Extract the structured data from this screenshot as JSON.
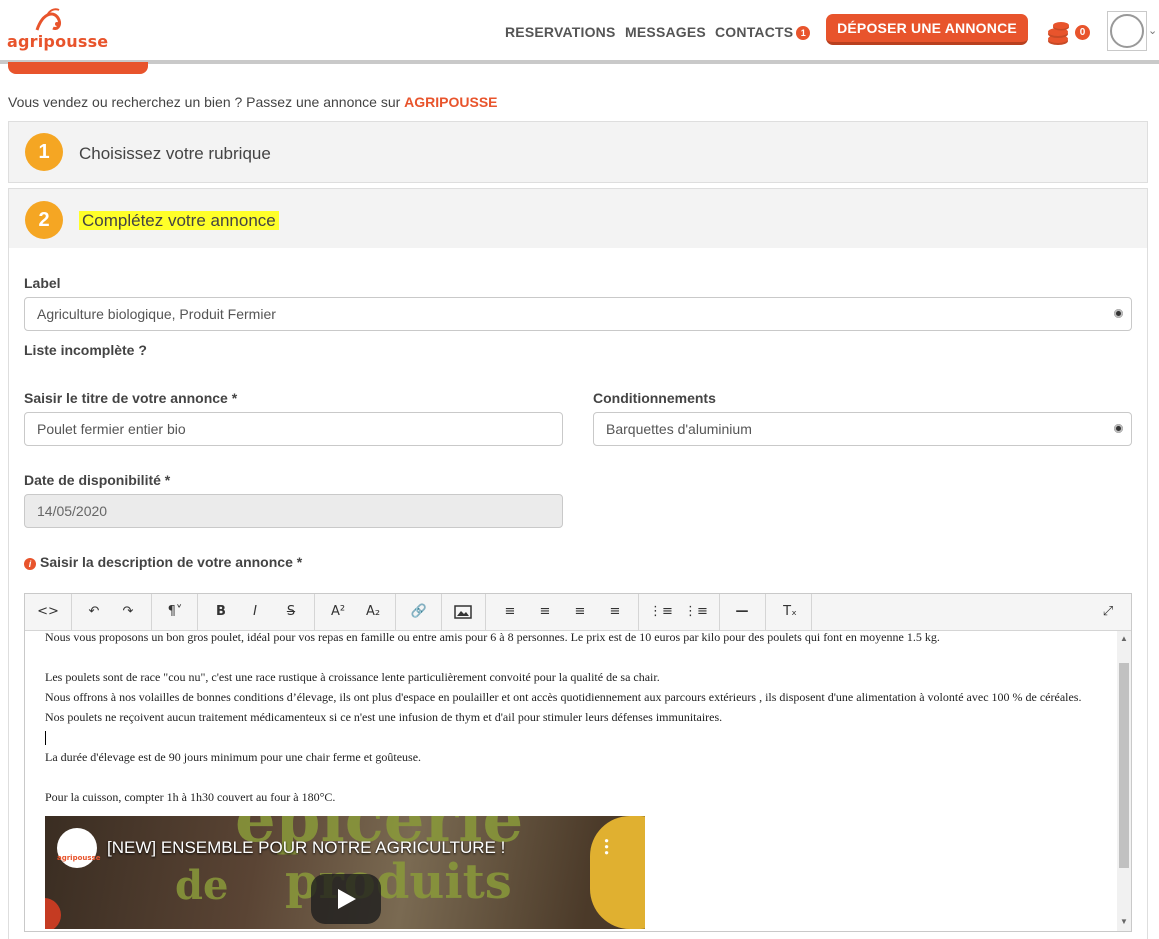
{
  "header": {
    "logo_text": "agripousse",
    "nav": [
      {
        "label": "RESERVATIONS"
      },
      {
        "label": "MESSAGES"
      },
      {
        "label": "CONTACTS",
        "badge": "1"
      }
    ],
    "deposit_button": "DÉPOSER UNE ANNONCE",
    "coins_count": "0",
    "colors": {
      "brand": "#e8542c",
      "step_badge": "#f5a623",
      "highlight": "#ffff29"
    }
  },
  "intro": {
    "text": "Vous vendez ou recherchez un bien ? Passez une annonce sur ",
    "brand": "AGRIPOUSSE"
  },
  "steps": [
    {
      "number": "1",
      "title": "Choisissez votre rubrique"
    },
    {
      "number": "2",
      "title": "Complétez votre annonce"
    }
  ],
  "form": {
    "label_title": "Label",
    "label_value": "Agriculture biologique, Produit Fermier",
    "incomplete_link": "Liste incomplète ?",
    "title_label": "Saisir le titre de votre annonce *",
    "title_value": "Poulet fermier entier bio",
    "packaging_label": "Conditionnements",
    "packaging_value": "Barquettes d'aluminium",
    "date_label": "Date de disponibilité *",
    "date_value": "14/05/2020",
    "description_label": "Saisir la description de votre annonce *"
  },
  "editor": {
    "toolbar_icons": [
      "source-icon",
      "undo-icon",
      "redo-icon",
      "paragraph-icon",
      "bold-icon",
      "italic-icon",
      "strikethrough-icon",
      "superscript-icon",
      "subscript-icon",
      "link-icon",
      "image-icon",
      "align-left-icon",
      "align-center-icon",
      "align-right-icon",
      "align-justify-icon",
      "bullet-list-icon",
      "numbered-list-icon",
      "horizontal-rule-icon",
      "clear-format-icon",
      "fullscreen-icon"
    ],
    "paragraphs": [
      "Nous vous proposons un bon gros poulet, idéal pour vos repas en famille ou entre amis pour 6 à 8 personnes. Le prix est de 10 euros par kilo pour des poulets qui font en moyenne 1.5 kg.",
      "",
      "Les poulets sont de race \"cou nu\", c'est une race rustique à croissance lente particulièrement convoité pour la qualité de sa chair.",
      "Nous offrons à nos volailles de bonnes conditions d’élevage, ils ont plus d'espace en poulailler et ont accès quotidiennement aux parcours extérieurs , ils disposent d'une alimentation à volonté avec 100 % de céréales. Nos poulets ne reçoivent aucun traitement médicamenteux si ce n'est une infusion de thym et d'ail pour stimuler leurs défenses immunitaires.",
      "La durée d'élevage est de 90 jours minimum pour une chair ferme et goûteuse.",
      "",
      "Pour la cuisson, compter 1h à 1h30 couvert au four à 180°C."
    ],
    "video": {
      "title": "[NEW] ENSEMBLE POUR NOTRE AGRICULTURE !",
      "channel_logo": "agripousse",
      "thumb_text_1": "épicerie",
      "thumb_text_2": "de",
      "thumb_text_3": "produits"
    }
  }
}
